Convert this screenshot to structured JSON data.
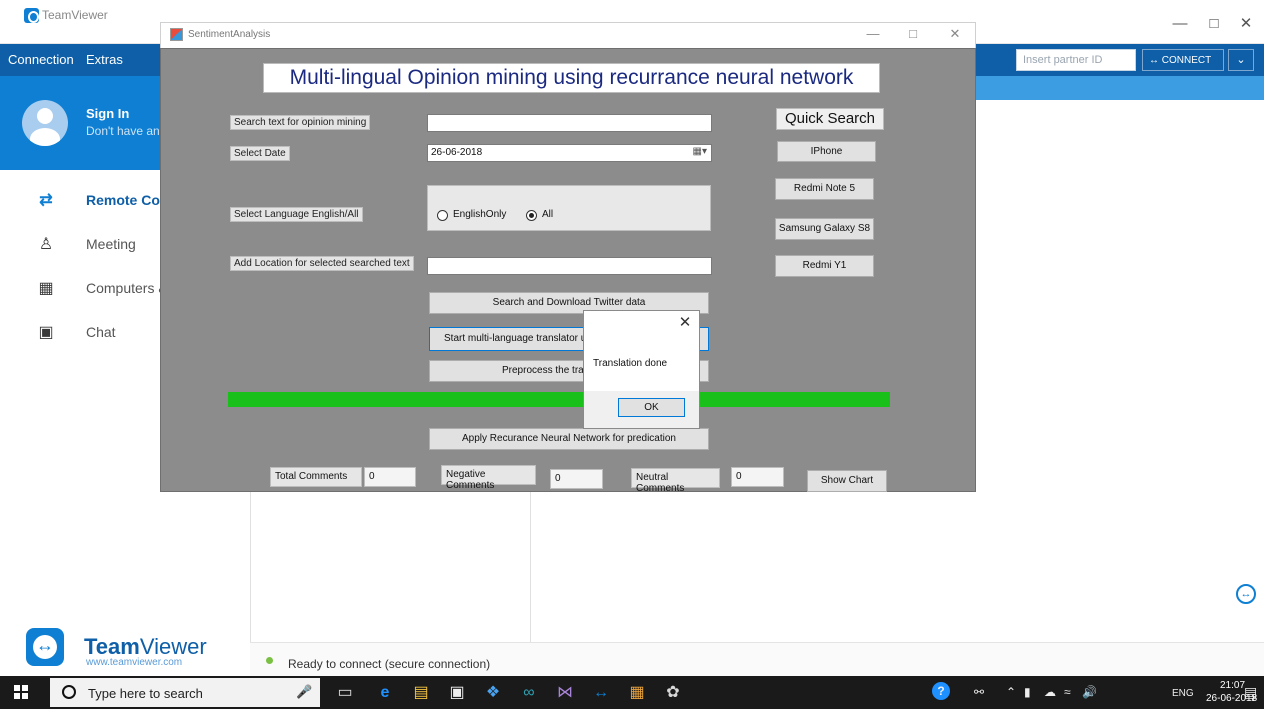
{
  "teamviewer": {
    "window_title": "TeamViewer",
    "menu": [
      "Connection",
      "Extras"
    ],
    "partner_placeholder": "Insert partner ID",
    "connect_label": "CONNECT",
    "signin_title": "Sign In",
    "signin_subtitle": "Don't have an",
    "nav": [
      {
        "label": "Remote Control",
        "icon": "arrows-icon"
      },
      {
        "label": "Meeting",
        "icon": "meeting-icon"
      },
      {
        "label": "Computers & Contacts",
        "icon": "contacts-icon"
      },
      {
        "label": "Chat",
        "icon": "chat-icon"
      }
    ],
    "brand_name_bold": "Team",
    "brand_name_light": "Viewer",
    "brand_url": "www.teamviewer.com",
    "status_text": "Ready to connect (secure connection)",
    "brand_color": "#0e7fd2"
  },
  "app": {
    "window_title": "SentimentAnalysis",
    "heading": "Multi-lingual Opinion mining using recurrance neural network",
    "labels": {
      "search": "Search text for opinion mining",
      "date": "Select Date",
      "language": "Select Language English/All",
      "location": "Add Location for selected searched text"
    },
    "inputs": {
      "search_value": "",
      "date_value": "26-06-2018",
      "location_value": ""
    },
    "language_options": [
      {
        "label": "EnglishOnly",
        "selected": false
      },
      {
        "label": "All",
        "selected": true
      }
    ],
    "quick_search": {
      "title": "Quick Search",
      "items": [
        "IPhone",
        "Redmi Note 5",
        "Samsung Galaxy S8",
        "Redmi Y1"
      ]
    },
    "buttons": {
      "download": "Search and Download Twitter data",
      "translate": "Start multi-language translator us",
      "preprocess": "Preprocess the tra",
      "apply": "Apply Recurance Neural Network for predication",
      "show_chart": "Show Chart"
    },
    "progress": 1.0,
    "progress_color": "#19c019",
    "counts": [
      {
        "label": "Total Comments",
        "value": "0"
      },
      {
        "label": "Negative Comments",
        "value": "0"
      },
      {
        "label": "Neutral Comments",
        "value": "0"
      }
    ]
  },
  "dialog": {
    "message": "Translation done",
    "ok_label": "OK"
  },
  "taskbar": {
    "search_placeholder": "Type here to search",
    "language": "ENG",
    "time": "21:07",
    "date": "26-06-2018",
    "notification_count": "1"
  }
}
